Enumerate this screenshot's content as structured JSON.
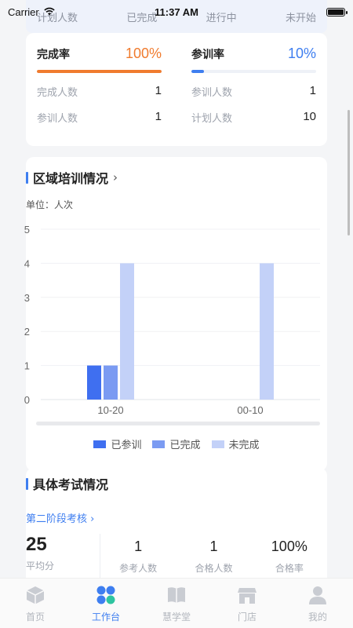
{
  "status_bar": {
    "carrier": "Carrier",
    "time": "11:37 AM"
  },
  "top_strip": {
    "items": [
      "计划人数",
      "已完成",
      "进行中",
      "未开始"
    ]
  },
  "rates": [
    {
      "title": "完成率",
      "value": "100%",
      "progress": 1.0,
      "color": "#f07b2e",
      "stats": [
        {
          "label": "完成人数",
          "value": "1"
        },
        {
          "label": "参训人数",
          "value": "1"
        }
      ]
    },
    {
      "title": "参训率",
      "value": "10%",
      "progress": 0.1,
      "color": "#3e7ef0",
      "stats": [
        {
          "label": "参训人数",
          "value": "1"
        },
        {
          "label": "计划人数",
          "value": "10"
        }
      ]
    }
  ],
  "region_section": {
    "title": "区域培训情况",
    "chevron": "›",
    "unit": "单位：人次"
  },
  "chart_data": {
    "type": "bar",
    "categories": [
      "10-20",
      "00-10"
    ],
    "series": [
      {
        "name": "已参训",
        "values": [
          1,
          0
        ],
        "color": "#3f6ff0"
      },
      {
        "name": "已完成",
        "values": [
          1,
          0
        ],
        "color": "#7b9bf2"
      },
      {
        "name": "未完成",
        "values": [
          4,
          4
        ],
        "color": "#c3d1f8"
      }
    ],
    "ylim": [
      0,
      5
    ],
    "yticks": [
      "0",
      "1",
      "2",
      "3",
      "4",
      "5"
    ],
    "legend": "bottom",
    "grid": true
  },
  "exam_section": {
    "title": "具体考试情况",
    "link": "第二阶段考核 ›",
    "avg": {
      "value": "25",
      "label": "平均分"
    },
    "items": [
      {
        "value": "1",
        "label": "参考人数"
      },
      {
        "value": "1",
        "label": "合格人数"
      },
      {
        "value": "100%",
        "label": "合格率"
      }
    ]
  },
  "tabs": [
    {
      "label": "首页",
      "icon": "cube-icon",
      "active": false
    },
    {
      "label": "工作台",
      "icon": "grid-icon",
      "active": true
    },
    {
      "label": "慧学堂",
      "icon": "book-icon",
      "active": false
    },
    {
      "label": "门店",
      "icon": "store-icon",
      "active": false
    },
    {
      "label": "我的",
      "icon": "user-icon",
      "active": false
    }
  ],
  "colors": {
    "accent": "#3e7ef0",
    "orange": "#f07b2e"
  }
}
